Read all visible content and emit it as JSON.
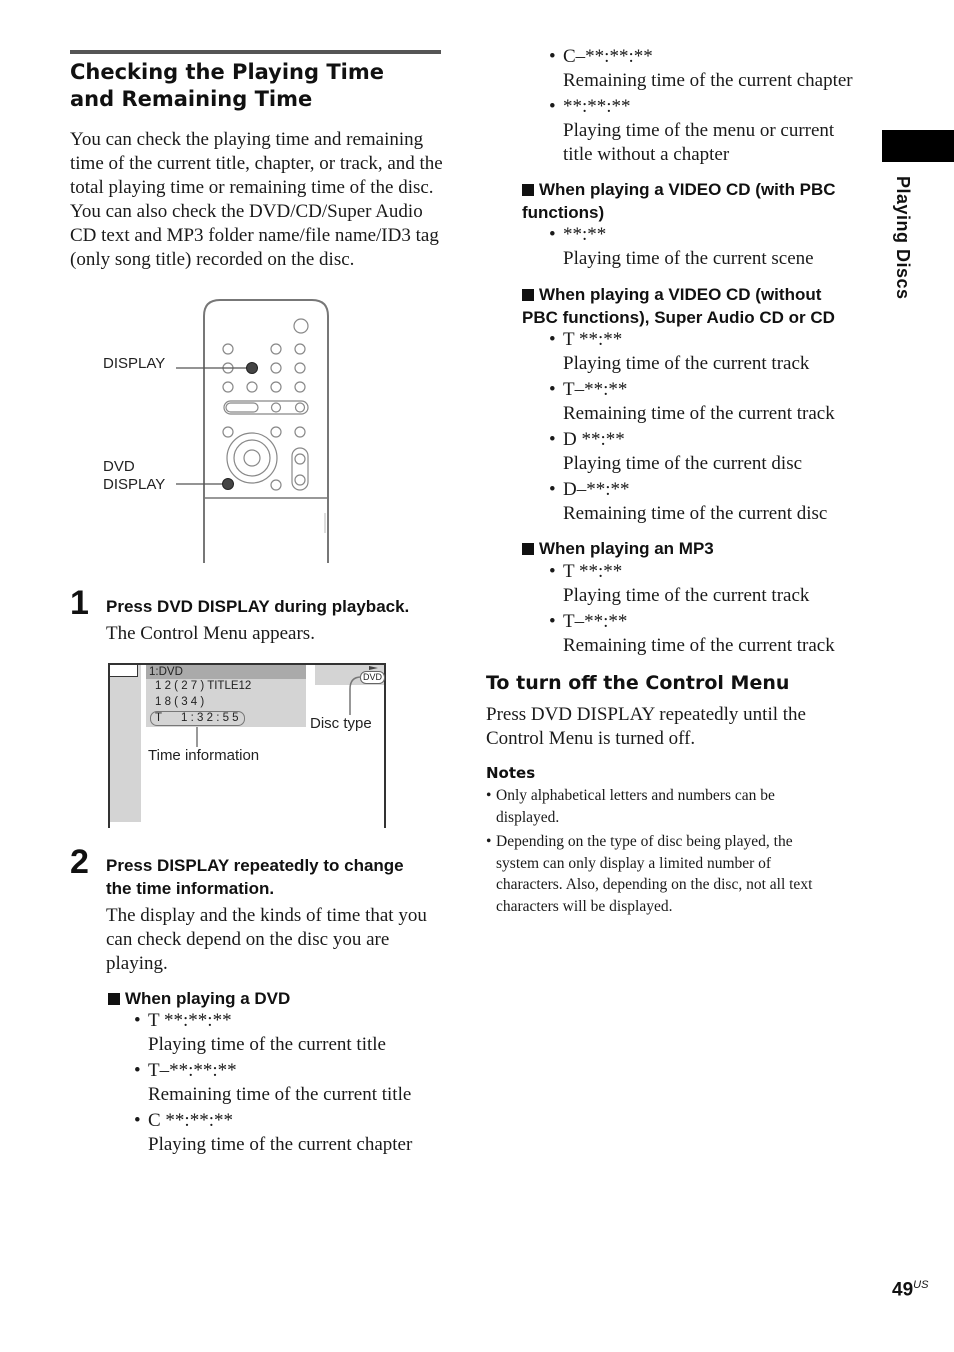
{
  "section": {
    "title_line1": "Checking the Playing Time",
    "title_line2": "and Remaining Time",
    "intro": [
      "You can check the playing time and remaining",
      "time of the current title, chapter, or track, and the",
      "total playing time or remaining time of the disc.",
      "You can also check the DVD/CD/Super Audio",
      "CD text and MP3 folder name/file name/ID3 tag",
      "(only song title) recorded on the disc."
    ]
  },
  "remote_figure": {
    "label_display": "DISPLAY",
    "label_dvd_display_1": "DVD",
    "label_dvd_display_2": "DISPLAY"
  },
  "steps": [
    {
      "number": "1",
      "title": "Press DVD DISPLAY during playback.",
      "body": "The Control Menu appears."
    },
    {
      "number": "2",
      "title_line1": "Press DISPLAY repeatedly to change",
      "title_line2": "the time information.",
      "body": [
        "The display and the kinds of time that you",
        "can check depend on the disc you are",
        "playing."
      ]
    }
  ],
  "osd_figure": {
    "disc_row": "1:DVD",
    "title_row": "1 2 ( 2 7 ) TITLE12",
    "chapter_row": "1 8 ( 3 4 )",
    "time_prefix": "T",
    "time_value": "1 : 3 2 : 5 5",
    "disc_badge": "DVD",
    "label_time_info": "Time information",
    "label_disc_type": "Disc type"
  },
  "dvd_section": {
    "heading": "When playing a DVD",
    "items": [
      {
        "code": "T **:**:**",
        "desc": [
          "Playing time of the current title"
        ]
      },
      {
        "code": "T–**:**:**",
        "desc": [
          "Remaining time of the current title"
        ]
      },
      {
        "code": "C **:**:**",
        "desc": [
          "Playing time of the current chapter"
        ]
      },
      {
        "code": "C–**:**:**",
        "desc": [
          "Remaining time of the current chapter"
        ]
      },
      {
        "code": "**:**:**",
        "desc": [
          "Playing time of the menu or current",
          "title without a chapter"
        ]
      }
    ]
  },
  "vcd_pbc_section": {
    "heading_line1": "When playing a VIDEO CD (with PBC",
    "heading_line2": "functions)",
    "items": [
      {
        "code": "**:**",
        "desc": [
          "Playing time of the current scene"
        ]
      }
    ]
  },
  "vcd_nopbc_section": {
    "heading_line1": "When playing a VIDEO CD (without",
    "heading_line2": "PBC functions), Super Audio CD or CD",
    "items": [
      {
        "code": "T **:**",
        "desc": [
          "Playing time of the current track"
        ]
      },
      {
        "code": "T–**:**",
        "desc": [
          "Remaining time of the current track"
        ]
      },
      {
        "code": "D **:**",
        "desc": [
          "Playing time of the current disc"
        ]
      },
      {
        "code": "D–**:**",
        "desc": [
          "Remaining time of the current disc"
        ]
      }
    ]
  },
  "mp3_section": {
    "heading": "When playing an MP3",
    "items": [
      {
        "code": "T **:**",
        "desc": [
          "Playing time of the current track"
        ]
      },
      {
        "code": "T–**:**",
        "desc": [
          "Remaining time of the current track"
        ]
      }
    ]
  },
  "turn_off": {
    "title": "To turn off the Control Menu",
    "body": [
      "Press DVD DISPLAY repeatedly until the",
      "Control Menu is turned off."
    ]
  },
  "notes": {
    "heading": "Notes",
    "items": [
      [
        "Only alphabetical letters and numbers can be",
        "displayed."
      ],
      [
        "Depending on the type of disc being played, the",
        "system can only display a limited number of",
        "characters. Also, depending on the disc, not all text",
        "characters will be displayed."
      ]
    ]
  },
  "side_tab": {
    "label": "Playing Discs"
  },
  "page": {
    "number": "49",
    "suffix": "US"
  }
}
